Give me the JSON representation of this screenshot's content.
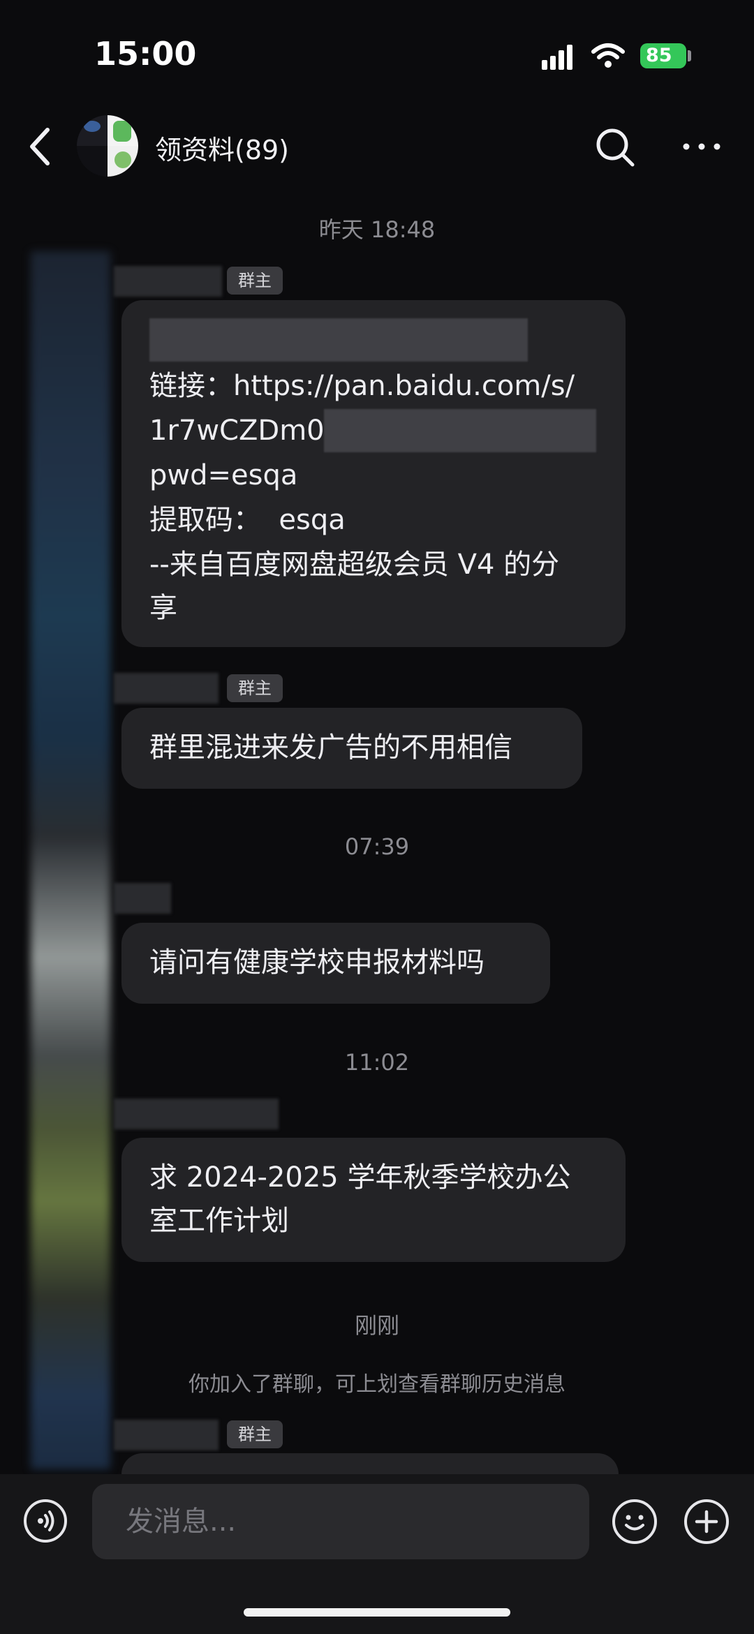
{
  "status_bar": {
    "time": "15:00",
    "battery": "85"
  },
  "header": {
    "title": "领资料(89)"
  },
  "messages": {
    "stamp1": "昨天 18:48",
    "owner_tag": "群主",
    "m1": {
      "line1_prefix": "链接：",
      "line1_url": "https://pan.baidu.com/s/",
      "line2": "1r7wCZDm0",
      "line3": "pwd=esqa",
      "line4": "提取码：  esqa",
      "line5": "--来自百度网盘超级会员 V4 的分",
      "line6": "享"
    },
    "m2": "群里混进来发广告的不用相信",
    "stamp2": "07:39",
    "m3": "请问有健康学校申报材料吗",
    "stamp3": "11:02",
    "m4_line1": "求 2024-2025 学年秋季学校办公",
    "m4_line2": "室工作计划",
    "stamp4": "刚刚",
    "system_notice": "你加入了群聊，可上划查看群聊历史消息"
  },
  "input_bar": {
    "placeholder": "发消息..."
  },
  "colors": {
    "background": "#0b0b0d",
    "bubble": "#232326",
    "battery": "#34c759"
  }
}
